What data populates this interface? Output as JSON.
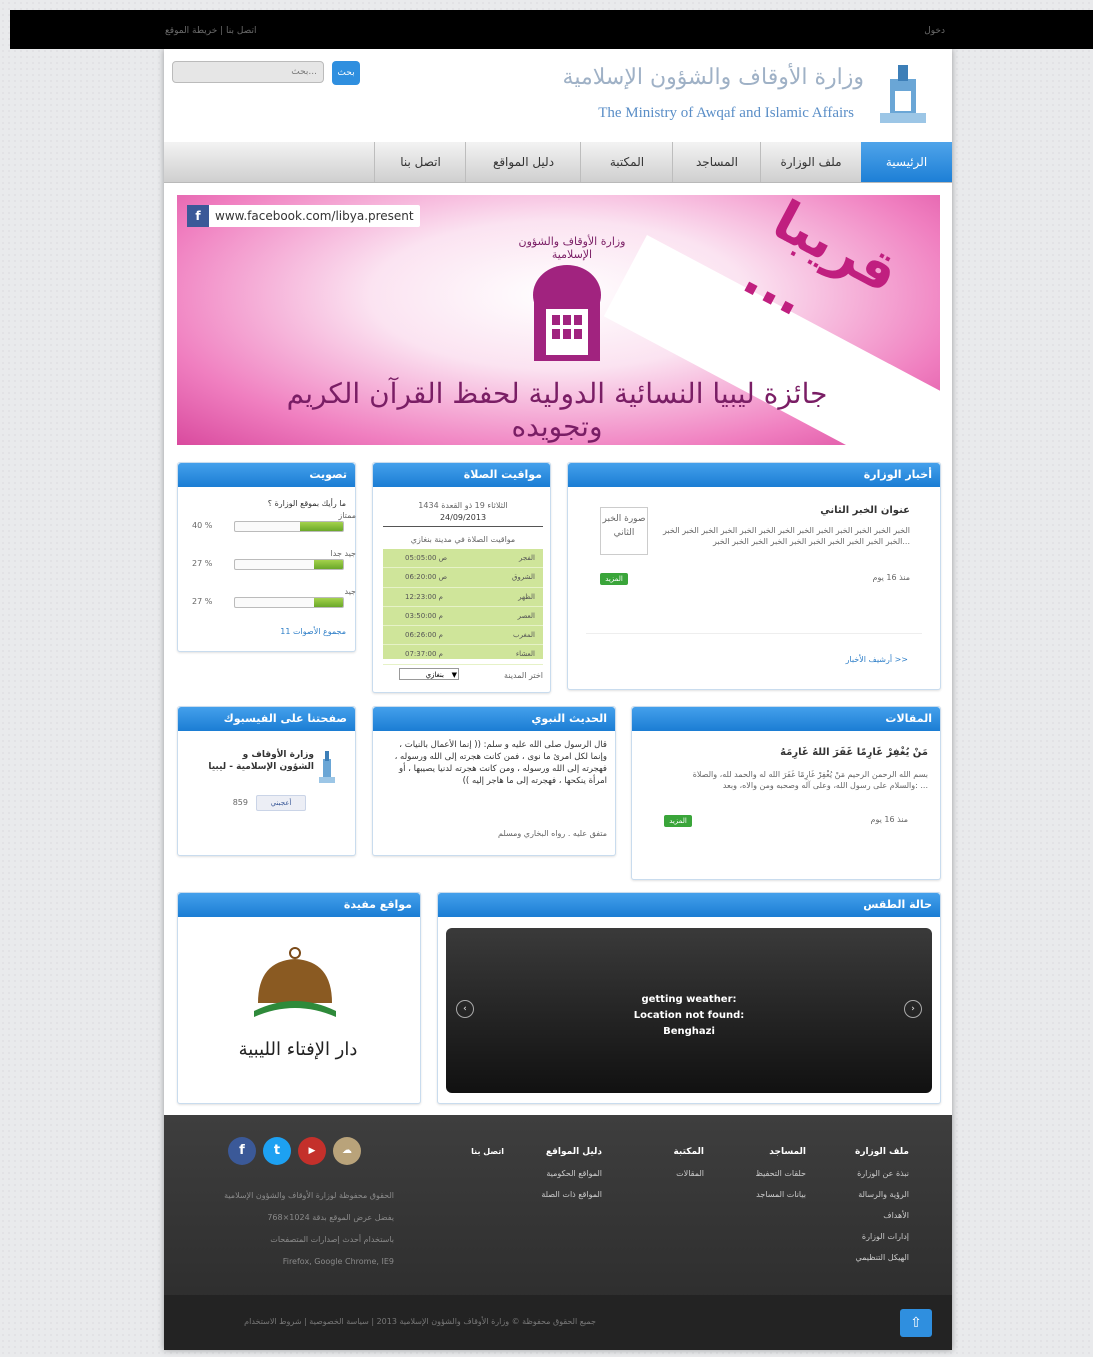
{
  "topbar": {
    "left_links": "اتصل بنا | خريطة الموقع",
    "right_text": "دخول"
  },
  "header": {
    "search_placeholder": "بحث...",
    "search_button": "بحث",
    "title_ar": "وزارة الأوقاف والشؤون الإسلامية",
    "title_en": "The Ministry of Awqaf and Islamic Affairs"
  },
  "nav": [
    "الرئيسية",
    "ملف الوزارة",
    "المساجد",
    "المكتبة",
    "دليل المواقع",
    "اتصل بنا"
  ],
  "banner": {
    "facebook_url": "www.facebook.com/libya.present",
    "soon": "قريبا ...",
    "ministry_label": "وزارة الأوقاف والشؤون الإسلامية",
    "title": "جائزة ليبيا النسائية الدولية لحفظ القرآن الكريم وتجويده"
  },
  "news": {
    "title": "أخبار الوزارة",
    "item_title": "عنوان الخبر الثاني",
    "item_body": "الخبر الخبر الخبر الخبر الخبر الخبر الخبر الخبر الخبر الخبر الخبر الخبر الخبر الخبر الخبر الخبر الخبر الخبر الخبر الخبر الخبر الخبر الخبر...",
    "thumb_text": "صورة الخبر الثاني",
    "date": "منذ 16 يوم",
    "more": "المزيد",
    "archive": "أرشيف الأخبار >>"
  },
  "prayer": {
    "title": "مواقيت الصلاة",
    "date_hijri": "الثلاثاء 19 ذو القعدة 1434",
    "date_greg": "24/09/2013",
    "caption": "مواقيت الصلاة في مدينة بنغازي",
    "rows": [
      {
        "name": "الفجر",
        "time": "05:05:00 ص"
      },
      {
        "name": "الشروق",
        "time": "06:20:00 ص"
      },
      {
        "name": "الظهر",
        "time": "12:23:00 م"
      },
      {
        "name": "العصر",
        "time": "03:50:00 م"
      },
      {
        "name": "المغرب",
        "time": "06:26:00 م"
      },
      {
        "name": "العشاء",
        "time": "07:37:00 م"
      }
    ],
    "city_label": "اختر المدينة",
    "city_value": "بنغازي"
  },
  "poll": {
    "title": "تصويت",
    "question": "ما رأيك بموقع الوزارة ؟",
    "options": [
      {
        "label": "ممتاز",
        "percent": "40 %",
        "fill": 0.4
      },
      {
        "label": "جيد جدا",
        "percent": "27 %",
        "fill": 0.27
      },
      {
        "label": "جيد",
        "percent": "27 %",
        "fill": 0.27
      }
    ],
    "total": "مجموع الأصوات 11"
  },
  "articles": {
    "title": "المقالات",
    "item_title": "مَنْ يُغْفِرْ غَارِمًا غَفَرَ اللهُ غَارِمَهُ",
    "item_body": "بسم الله الرحمن الرحيم مَنْ يُغْفِرْ غَارِمًا غَفَرَ الله له والحمد لله، والصلاة والسلام على رسول الله، وعلى آله وصحبه ومن والاه، وبعد: ...",
    "date": "منذ 16 يوم",
    "more": "المزيد"
  },
  "hadith": {
    "title": "الحديث النبوي",
    "body": "قال الرسول صلى الله عليه و سلم: (( إنما الأعمال بالنيات ، وإنما لكل امرئ ما نوى ، فمن كانت هجرته إلى الله ورسوله ، فهجرته إلى الله ورسوله ، ومن كانت هجرته لدنيا يصيبها ، أو امرأة ينكحها ، فهجرته إلى ما هاجر إليه ))",
    "source": "متفق عليه . رواه البخاري ومسلم"
  },
  "facebook_box": {
    "title": "صفحتنا على الفيسبوك",
    "page_name": "وزارة الأوقاف و الشؤون الإسلامية - ليبيا",
    "like": "أعجبني",
    "count": "859"
  },
  "weather": {
    "title": "حالة الطقس",
    "line1": "getting weather:",
    "line2": "Location not found:",
    "line3": "Benghazi"
  },
  "links": {
    "title": "مواقع مفيدة",
    "logo_text": "دار الإفتاء الليبية"
  },
  "footer": {
    "columns": [
      {
        "head": "ملف الوزارة",
        "items": [
          "نبذة عن الوزارة",
          "الرؤية والرسالة",
          "الأهداف",
          "إدارات الوزارة",
          "الهيكل التنظيمي"
        ]
      },
      {
        "head": "المساجد",
        "items": [
          "حلقات التحفيظ",
          "بيانات المساجد"
        ]
      },
      {
        "head": "المكتبة",
        "items": [
          "المقالات"
        ]
      },
      {
        "head": "دليل المواقع",
        "items": [
          "المواقع الحكومية",
          "المواقع ذات الصلة"
        ]
      },
      {
        "head": "",
        "items": [
          "اتصل بنا"
        ]
      }
    ],
    "info": [
      "الحقوق محفوظة لوزارة الأوقاف والشؤون الإسلامية",
      "يفضل عرض الموقع بدقة 1024×768",
      "باستخدام أحدث إصدارات المتصفحات",
      "Firefox, Google Chrome, IE9"
    ],
    "copyright": "جميع الحقوق محفوظة © وزارة الأوقاف والشؤون الإسلامية 2013 | سياسة الخصوصية | شروط الاستخدام",
    "top_icon": "arrow-up"
  },
  "colors": {
    "accent": "#2f8fdf",
    "banner": "#d94a9e",
    "footer": "#333333"
  }
}
